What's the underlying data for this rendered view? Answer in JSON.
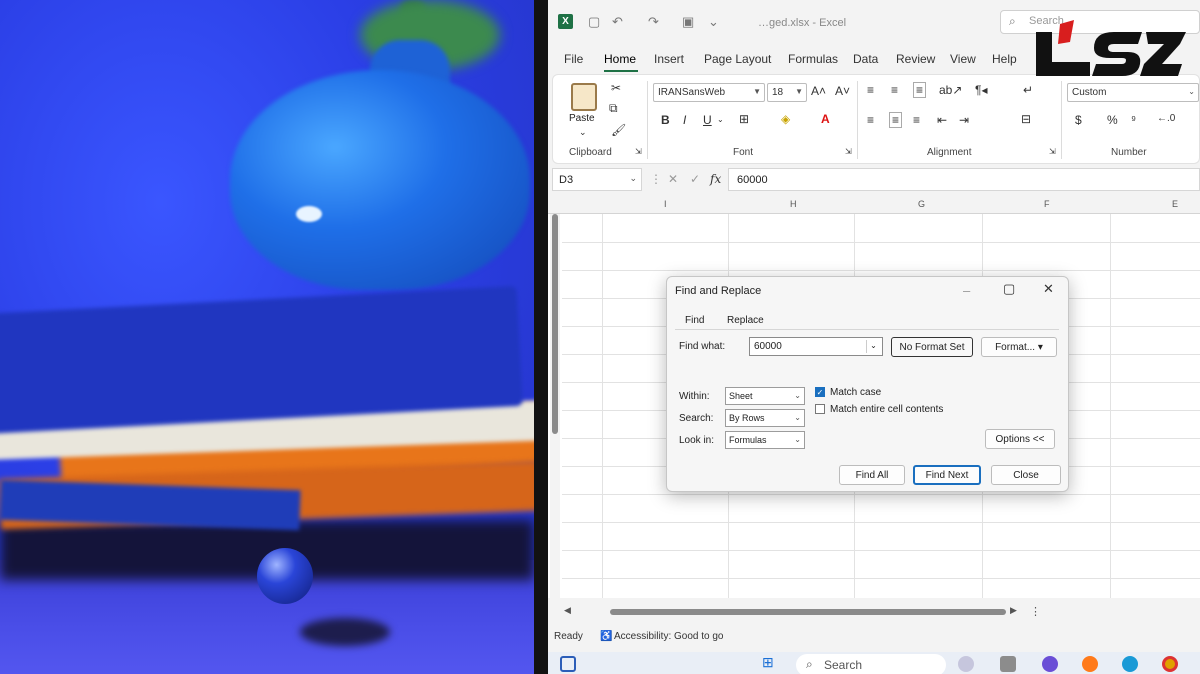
{
  "brand": {
    "name": "logo"
  },
  "excel": {
    "doc_title": "…ged.xlsx  -  Excel",
    "search_placeholder": "Search",
    "ribbon_tabs": [
      "File",
      "Home",
      "Insert",
      "Page Layout",
      "Formulas",
      "Data",
      "Review",
      "View",
      "Help"
    ],
    "active_tab": "Home",
    "clipboard": {
      "paste_label": "Paste",
      "group_label": "Clipboard"
    },
    "font": {
      "family": "IRANSansWeb",
      "size": "18",
      "group_label": "Font"
    },
    "alignment": {
      "group_label": "Alignment"
    },
    "number": {
      "format": "Custom",
      "group_label": "Number",
      "percent": "%"
    },
    "namebox": "D3",
    "formula_value": "60000",
    "columns": [
      "I",
      "H",
      "G",
      "F",
      "E"
    ],
    "status": {
      "ready": "Ready",
      "accessibility": "Accessibility: Good to go"
    },
    "taskbar_search": "Search"
  },
  "dialog": {
    "title": "Find and Replace",
    "tabs": [
      "Find",
      "Replace"
    ],
    "find_what_label": "Find what:",
    "find_what_value": "60000",
    "no_format_label": "No Format Set",
    "format_label": "Format...",
    "within_label": "Within:",
    "within_value": "Sheet",
    "search_label": "Search:",
    "search_value": "By Rows",
    "lookin_label": "Look in:",
    "lookin_value": "Formulas",
    "match_case_label": "Match case",
    "match_case_checked": true,
    "match_entire_label": "Match entire cell contents",
    "match_entire_checked": false,
    "options_label": "Options <<",
    "find_all_label": "Find All",
    "find_next_label": "Find Next",
    "close_label": "Close"
  },
  "colors": {
    "excel_green": "#1e7145",
    "accent_blue": "#1a6fbf",
    "brand_red": "#d81e1e"
  }
}
